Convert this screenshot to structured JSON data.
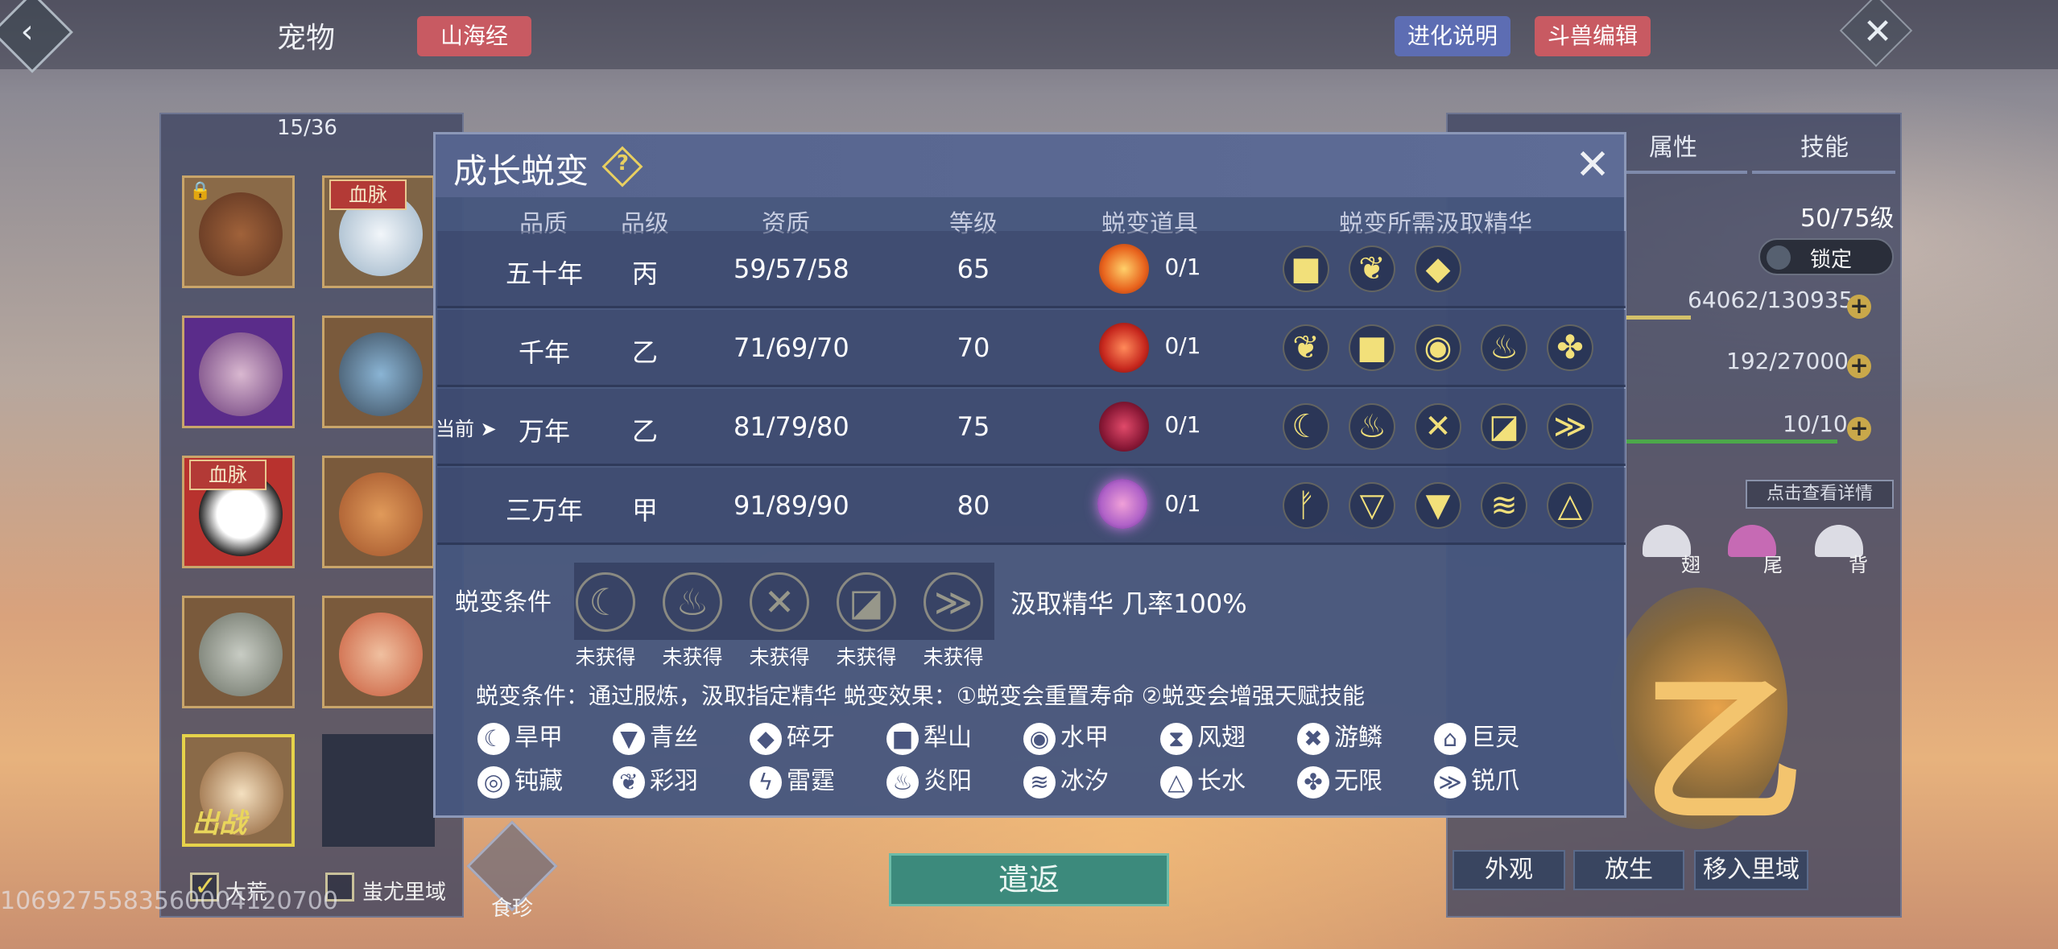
{
  "header": {
    "title": "宠物",
    "shanhai_label": "山海经",
    "evolution_help_label": "进化说明",
    "beast_edit_label": "斗兽编辑"
  },
  "left": {
    "count": "15/36",
    "blood_tag": "血脉",
    "chuzhan": "出战",
    "filter_dahuang": "大荒",
    "filter_chiyou": "蚩尤里域",
    "filter_dahuang_checked": true,
    "filter_chiyou_checked": false,
    "player_id": "1069275583560004120700",
    "food_label": "食珍"
  },
  "right": {
    "tab_attr": "属性",
    "tab_skill": "技能",
    "level": "50/75级",
    "lock_label": "锁定",
    "stat1": "64062/130935",
    "stat2": "192/27000",
    "stat3": "10/10",
    "detail_btn": "点击查看详情",
    "part_wing": "翅",
    "part_tail": "尾",
    "part_back": "背",
    "btn_appearance": "外观",
    "btn_release": "放生",
    "btn_move": "移入里域"
  },
  "return_label": "遣返",
  "modal": {
    "title": "成长蜕变",
    "headers": [
      "品质",
      "品级",
      "资质",
      "等级",
      "蜕变道具",
      "蜕变所需汲取精华"
    ],
    "current_label": "当前",
    "rows": [
      {
        "quality": "五十年",
        "grade": "丙",
        "aptitude": "59/57/58",
        "level": "65",
        "item_count": "0/1",
        "orb_color": "#e8631d",
        "essences": [
          "■",
          "❦",
          "◆"
        ]
      },
      {
        "quality": "千年",
        "grade": "乙",
        "aptitude": "71/69/70",
        "level": "70",
        "item_count": "0/1",
        "orb_color": "#c7281e",
        "essences": [
          "❦",
          "■",
          "◉",
          "♨",
          "✤"
        ]
      },
      {
        "quality": "万年",
        "grade": "乙",
        "aptitude": "81/79/80",
        "level": "75",
        "item_count": "0/1",
        "orb_color": "#8a1836",
        "essences": [
          "☾",
          "♨",
          "✕",
          "◪",
          "≫"
        ]
      },
      {
        "quality": "三万年",
        "grade": "甲",
        "aptitude": "91/89/90",
        "level": "80",
        "item_count": "0/1",
        "orb_color": "#b062c8",
        "essences": [
          "ᚠ",
          "▽",
          "▼",
          "≋",
          "△"
        ]
      }
    ],
    "condition_label": "蜕变条件",
    "conditions": [
      {
        "glyph": "☾",
        "status": "未获得"
      },
      {
        "glyph": "♨",
        "status": "未获得"
      },
      {
        "glyph": "✕",
        "status": "未获得"
      },
      {
        "glyph": "◪",
        "status": "未获得"
      },
      {
        "glyph": "≫",
        "status": "未获得"
      }
    ],
    "rate_text": "汲取精华 几率100%",
    "desc_text": "蜕变条件：通过服炼，汲取指定精华    蜕变效果：①蜕变会重置寿命 ②蜕变会增强天赋技能",
    "legend": [
      {
        "glyph": "☾",
        "name": "旱甲"
      },
      {
        "glyph": "▼",
        "name": "青丝"
      },
      {
        "glyph": "◆",
        "name": "碎牙"
      },
      {
        "glyph": "■",
        "name": "犁山"
      },
      {
        "glyph": "◉",
        "name": "水甲"
      },
      {
        "glyph": "⧗",
        "name": "风翅"
      },
      {
        "glyph": "✖",
        "name": "游鳞"
      },
      {
        "glyph": "⌂",
        "name": "巨灵"
      },
      {
        "glyph": "◎",
        "name": "钝藏"
      },
      {
        "glyph": "❦",
        "name": "彩羽"
      },
      {
        "glyph": "ϟ",
        "name": "雷霆"
      },
      {
        "glyph": "♨",
        "name": "炎阳"
      },
      {
        "glyph": "≋",
        "name": "冰汐"
      },
      {
        "glyph": "△",
        "name": "长水"
      },
      {
        "glyph": "✤",
        "name": "无限"
      },
      {
        "glyph": "≫",
        "name": "锐爪"
      }
    ]
  },
  "colors": {
    "accent_gold": "#f2e07a",
    "tag_red": "#c85a62",
    "tag_blue": "#5d6db3",
    "return_green": "#3c8a7c"
  }
}
